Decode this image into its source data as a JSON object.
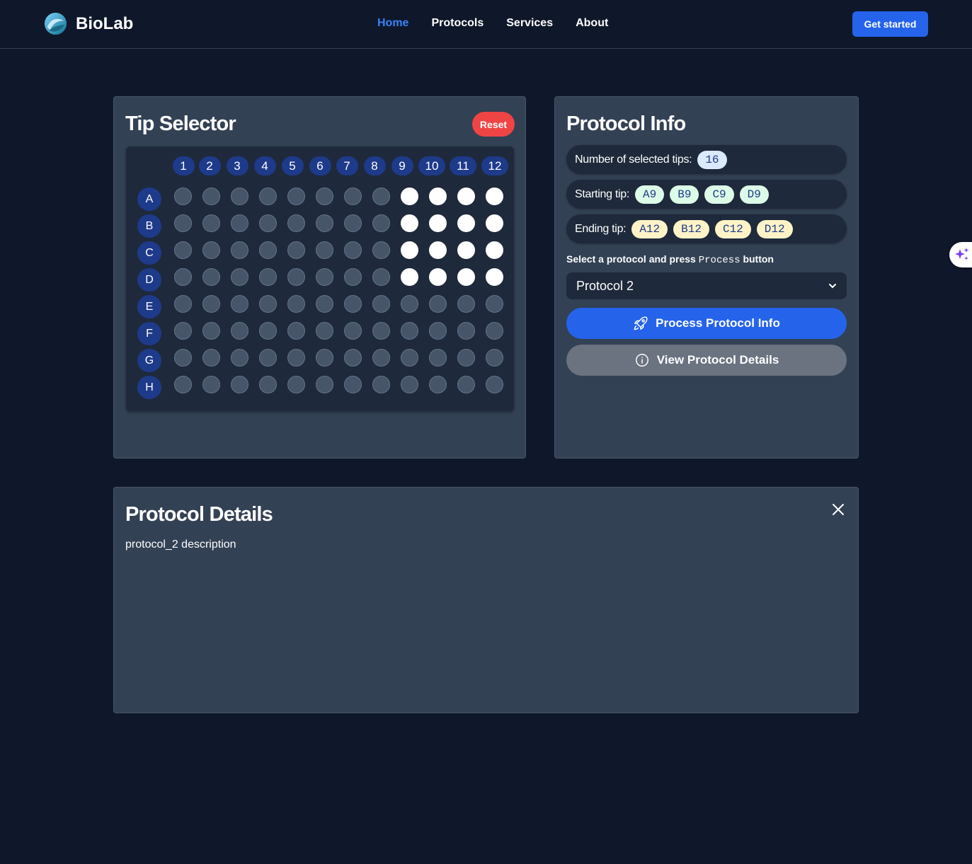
{
  "header": {
    "brand": "BioLab",
    "nav": [
      {
        "label": "Home",
        "active": true
      },
      {
        "label": "Protocols",
        "active": false
      },
      {
        "label": "Services",
        "active": false
      },
      {
        "label": "About",
        "active": false
      }
    ],
    "cta": "Get started"
  },
  "tip_selector": {
    "title": "Tip Selector",
    "reset_label": "Reset",
    "columns": [
      "1",
      "2",
      "3",
      "4",
      "5",
      "6",
      "7",
      "8",
      "9",
      "10",
      "11",
      "12"
    ],
    "rows": [
      "A",
      "B",
      "C",
      "D",
      "E",
      "F",
      "G",
      "H"
    ],
    "selected": [
      "A9",
      "A10",
      "A11",
      "A12",
      "B9",
      "B10",
      "B11",
      "B12",
      "C9",
      "C10",
      "C11",
      "C12",
      "D9",
      "D10",
      "D11",
      "D12"
    ]
  },
  "protocol_info": {
    "title": "Protocol Info",
    "count_label": "Number of selected tips:",
    "count_value": "16",
    "start_label": "Starting tip:",
    "start_tips": [
      "A9",
      "B9",
      "C9",
      "D9"
    ],
    "end_label": "Ending tip:",
    "end_tips": [
      "A12",
      "B12",
      "C12",
      "D12"
    ],
    "hint_prefix": "Select a protocol and press",
    "hint_code": "Process",
    "hint_suffix": "button",
    "selected_protocol": "Protocol 2",
    "process_label": "Process Protocol Info",
    "details_label": "View Protocol Details"
  },
  "protocol_details": {
    "title": "Protocol Details",
    "description": "protocol_2 description"
  },
  "colors": {
    "background": "#0f172a",
    "panel": "#334155",
    "accent": "#2563eb",
    "danger": "#ef4444",
    "label_badge": "#1e3a8a"
  }
}
